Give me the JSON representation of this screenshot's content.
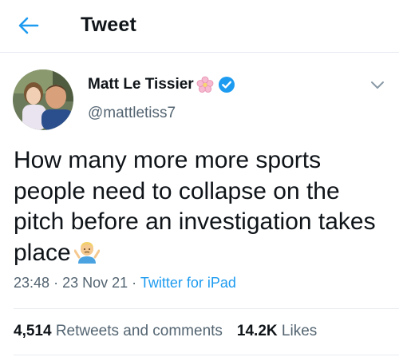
{
  "header": {
    "title": "Tweet"
  },
  "author": {
    "display_name": "Matt Le Tissier",
    "handle": "@mattletiss7"
  },
  "tweet": {
    "text": "How many more more sports people need to collapse on the pitch before an investigation takes place",
    "time": "23:48",
    "date": "23 Nov 21",
    "separator": "·",
    "source": "Twitter for iPad"
  },
  "stats": {
    "retweets_count": "4,514",
    "retweets_label": "Retweets and comments",
    "likes_count": "14.2K",
    "likes_label": "Likes"
  },
  "colors": {
    "accent": "#1d9bf0",
    "secondary_text": "#536471",
    "divider": "#e6ecf0"
  },
  "icons": {
    "back": "arrow-left-icon",
    "flower": "cherry-blossom-icon",
    "verified": "verified-badge-icon",
    "more": "chevron-down-icon",
    "emoji": "man-shrugging-emoji"
  }
}
